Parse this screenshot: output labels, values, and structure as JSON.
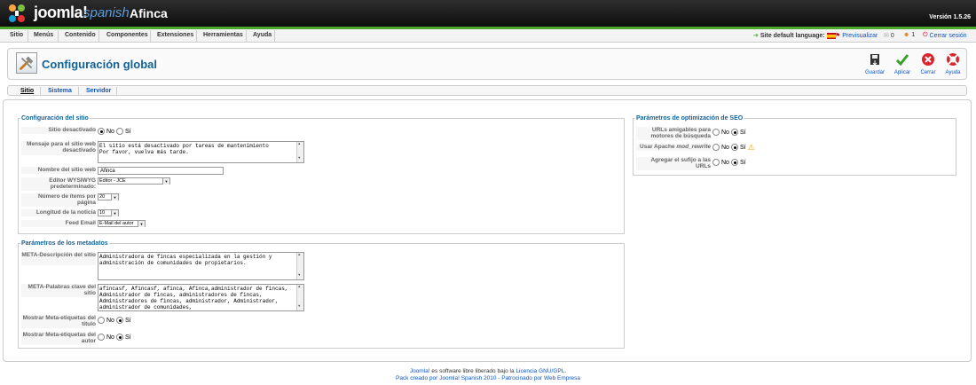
{
  "header": {
    "brand": "joomla!",
    "brand_sub": "spanish",
    "site_name": "Afinca",
    "version": "Versión 1.5.26"
  },
  "menu": [
    "Sitio",
    "Menús",
    "Contenido",
    "Componentes",
    "Extensiones",
    "Herramientas",
    "Ayuda"
  ],
  "status": {
    "site_language": "Site default language:",
    "preview": "Previsualizar",
    "messages": "0",
    "users": "1",
    "logout": "Cerrar sesión"
  },
  "page": {
    "title": "Configuración global"
  },
  "toolbar": {
    "save": "Guardar",
    "apply": "Aplicar",
    "close": "Cerrar",
    "help": "Ayuda"
  },
  "tabs": [
    "Sitio",
    "Sistema",
    "Servidor"
  ],
  "site": {
    "legend": "Configuración del sitio",
    "offline_label": "Sitio desactivado",
    "offline_message_label": "Mensaje para el sitio web desactivado",
    "offline_message": "El sitio está desactivado por tareas de mantenimiento\nPor favor, vuelva más tarde.",
    "site_name_label": "Nombre del sitio web",
    "site_name": "Afinca",
    "editor_label": "Editor WYSIWYG predeterminado:",
    "editor": "Editor - JCE",
    "list_limit_label": "Número de ítems por página",
    "list_limit": "20",
    "feed_length_label": "Longitud de la noticia",
    "feed_length": "10",
    "feed_email_label": "Feed Email",
    "feed_email": "E-Mail del autor"
  },
  "metadata": {
    "legend": "Parámetros de los metadatos",
    "desc_label": "META-Descripción del sitio",
    "desc": "Administradora de fincas especializada en la gestión y administración de comunidades de propietarios.",
    "keywords_label": "META-Palabras clave del sitio",
    "keywords": "afincasf, Afincasf, afinca, Afinca,administrador de fincas, Administrador de fincas, administradores de fincas, Administradores de fincas, administrador, Administrador, administrador de comunidades,",
    "show_title_label": "Mostrar Meta-etiquetas del título",
    "show_author_label": "Mostrar Meta-etiquetas del autor"
  },
  "seo": {
    "legend": "Parámetros de optimización de SEO",
    "sef_label": "URLs amigables para motores de búsqueda",
    "rewrite_label_pre": "Usar Apache ",
    "rewrite_label_em": "mod_rewrite",
    "suffix_label": "Agregar el sufijo a las URLs"
  },
  "options": {
    "no": "No",
    "yes": "Sí"
  },
  "footer": {
    "line1_link1": "Joomla!",
    "line1_text": " es software libre liberado bajo la ",
    "line1_link2": "Licencia GNU/GPL",
    "line1_end": ".",
    "line2_pre": "Pack creado por ",
    "line2_link1": "Joomla! Spanish 2010",
    "line2_mid": " - Patrocinado por ",
    "line2_link2": "Web Empresa"
  },
  "colors": {
    "accent": "#146295",
    "link": "#0b55c4",
    "topbar_green": "#4ca72b"
  }
}
